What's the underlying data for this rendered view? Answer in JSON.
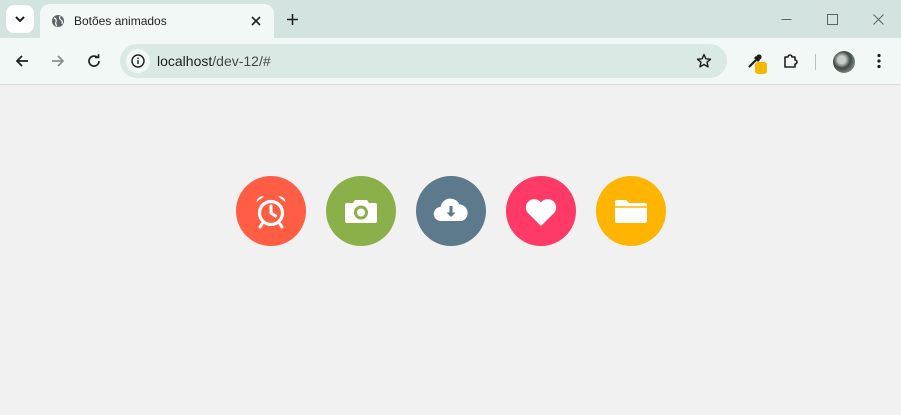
{
  "browser": {
    "tab_title": "Botões animados",
    "url_host": "localhost",
    "url_path": "/dev-12/#"
  },
  "buttons": [
    {
      "name": "alarm-clock",
      "color": "#ff5e45"
    },
    {
      "name": "camera",
      "color": "#8bb049"
    },
    {
      "name": "cloud-download",
      "color": "#5d798c"
    },
    {
      "name": "heart",
      "color": "#ff3a66"
    },
    {
      "name": "folder",
      "color": "#ffb500"
    }
  ]
}
